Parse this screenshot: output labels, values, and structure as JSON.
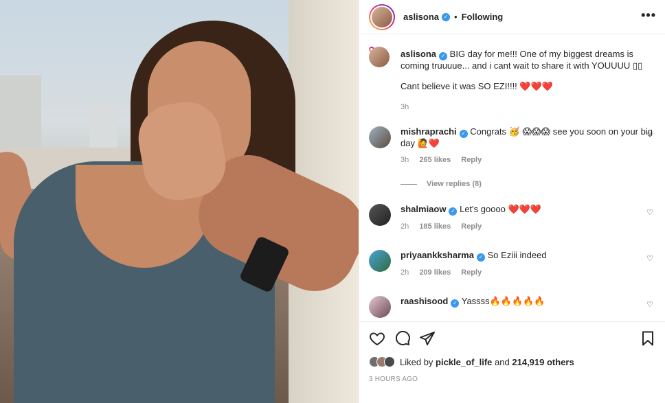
{
  "header": {
    "username": "aslisona",
    "follow_status": "Following",
    "separator": "•",
    "more": "•••"
  },
  "caption": {
    "username": "aslisona",
    "text_line1": "BIG day for me!!! One of my biggest dreams is coming truuuue... and i cant wait to share it with YOUUUU",
    "text_line2": "Cant believe it was SO EZI!!!!",
    "emoji": "❤️❤️❤️",
    "time": "3h"
  },
  "comments": [
    {
      "username": "mishraprachi",
      "text": "Congrats 🥳 😱😱😱 see you soon on your big day 🙋❤️",
      "time": "3h",
      "likes": "265 likes",
      "reply": "Reply",
      "view_replies": "View replies (8)"
    },
    {
      "username": "shalmiaow",
      "text": "Let's goooo ❤️❤️❤️",
      "time": "2h",
      "likes": "185 likes",
      "reply": "Reply"
    },
    {
      "username": "priyaankksharma",
      "text": "So Eziii indeed",
      "time": "2h",
      "likes": "209 likes",
      "reply": "Reply"
    },
    {
      "username": "raashisood",
      "text": "Yassss🔥🔥🔥🔥🔥",
      "time": "",
      "likes": "",
      "reply": ""
    }
  ],
  "likes": {
    "prefix": "Liked by",
    "user": "pickle_of_life",
    "and": "and",
    "count": "214,919 others"
  },
  "timestamp": "3 HOURS AGO",
  "icons": [
    "heart-icon",
    "comment-icon",
    "share-icon",
    "bookmark-icon",
    "verified-icon",
    "more-icon"
  ],
  "colors": {
    "verified": "#3897f0",
    "heart": "#ed4956",
    "muted": "#8e8e8e"
  }
}
